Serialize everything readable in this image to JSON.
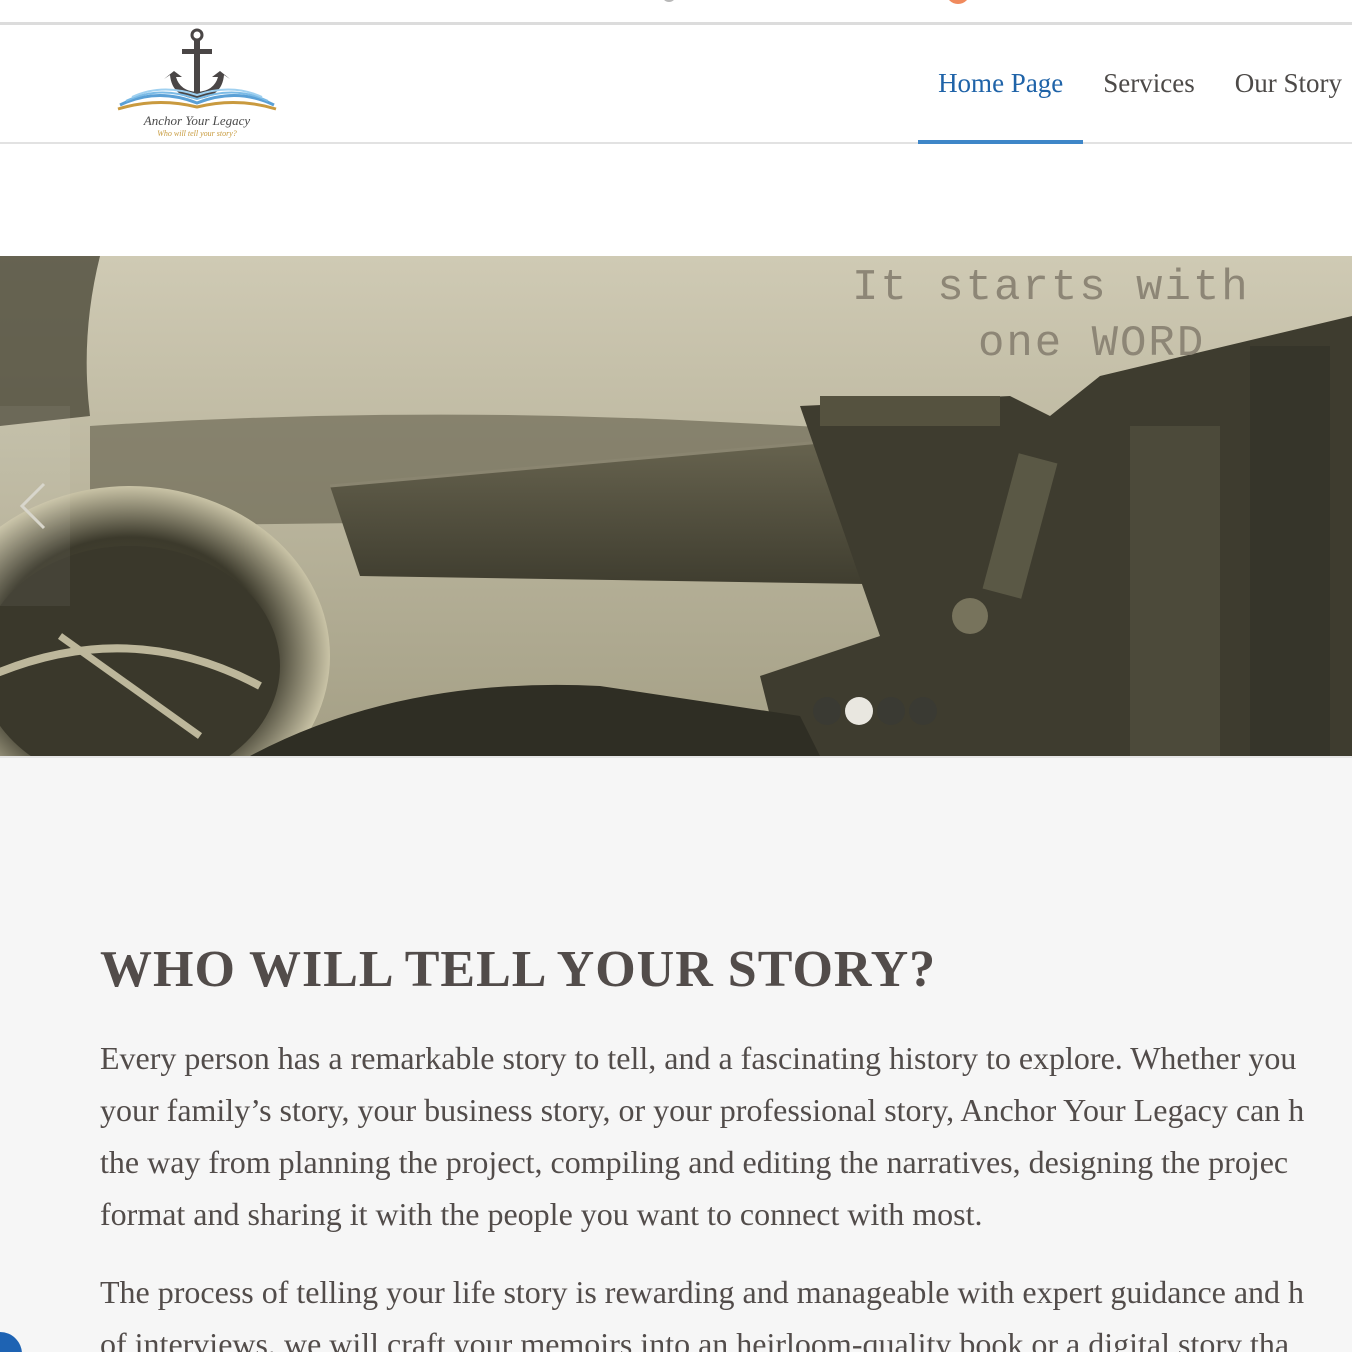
{
  "header": {
    "logo": {
      "name": "Anchor Your Legacy",
      "tagline": "Who will tell your story?"
    },
    "nav": [
      {
        "label": "Home Page",
        "active": true
      },
      {
        "label": "Services",
        "active": false
      },
      {
        "label": "Our Story",
        "active": false
      }
    ]
  },
  "hero": {
    "caption_line1": "It starts with",
    "caption_line2": "one WORD",
    "prev_icon": "chevron-left-icon",
    "slides_total": 4,
    "active_slide": 2
  },
  "content": {
    "heading": "WHO WILL TELL YOUR STORY?",
    "paragraph1_lines": [
      "Every person has a remarkable story to tell, and a fascinating history to explore. Whether you",
      "your family’s story, your business story, or your professional story, Anchor Your Legacy can h",
      "the way from planning the project, compiling and editing the narratives, designing the projec",
      "format and sharing it with the people you want to connect with most."
    ],
    "paragraph2_lines": [
      "The process of telling your life story is rewarding and manageable with expert guidance and h",
      "of interviews, we will craft your memoirs into an heirloom-quality book or a digital story tha"
    ]
  },
  "colors": {
    "nav_active": "#1f63a8",
    "nav_underline": "#3e86c8",
    "text": "#524c4a",
    "content_bg": "#f6f6f6"
  }
}
